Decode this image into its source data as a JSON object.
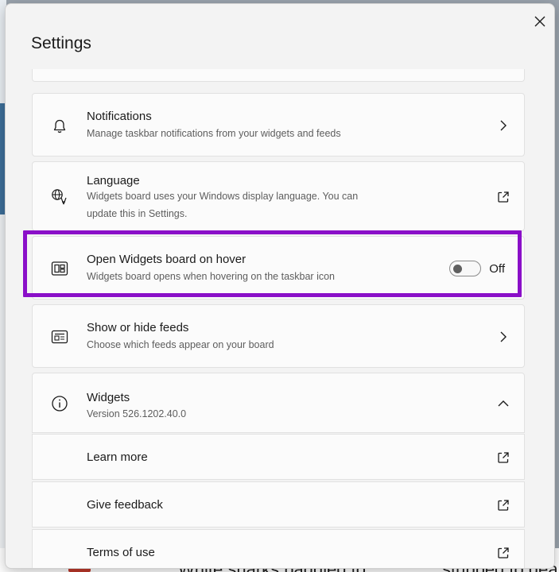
{
  "dialog": {
    "title": "Settings"
  },
  "colors": {
    "highlight": "#8a0fc8",
    "dialog_bg": "#f3f3f3",
    "card_bg": "#fbfbfb"
  },
  "items": {
    "notifications": {
      "icon": "bell-icon",
      "title": "Notifications",
      "description": "Manage taskbar notifications from your widgets and feeds",
      "action_icon": "chevron-right-icon"
    },
    "language": {
      "icon": "language-icon",
      "title": "Language",
      "description": "Widgets board uses your Windows display language. You can update this in Settings.",
      "action_icon": "open-external-icon"
    },
    "hover": {
      "icon": "widgets-board-icon",
      "title": "Open Widgets board on hover",
      "description": "Widgets board opens when hovering on the taskbar icon",
      "toggle_label": "Off",
      "toggle_on": false
    },
    "feeds": {
      "icon": "news-feed-icon",
      "title": "Show or hide feeds",
      "description": "Choose which feeds appear on your board",
      "action_icon": "chevron-right-icon"
    },
    "widgets": {
      "icon": "info-icon",
      "title": "Widgets",
      "version": "Version 526.1202.40.0",
      "action_icon": "chevron-up-icon",
      "links": [
        {
          "label": "Learn more",
          "icon": "open-external-icon"
        },
        {
          "label": "Give feedback",
          "icon": "open-external-icon"
        },
        {
          "label": "Terms of use",
          "icon": "open-external-icon"
        }
      ]
    }
  },
  "background": {
    "left_text": "White sharks baddled to",
    "right_text": "stubbed to dea"
  }
}
